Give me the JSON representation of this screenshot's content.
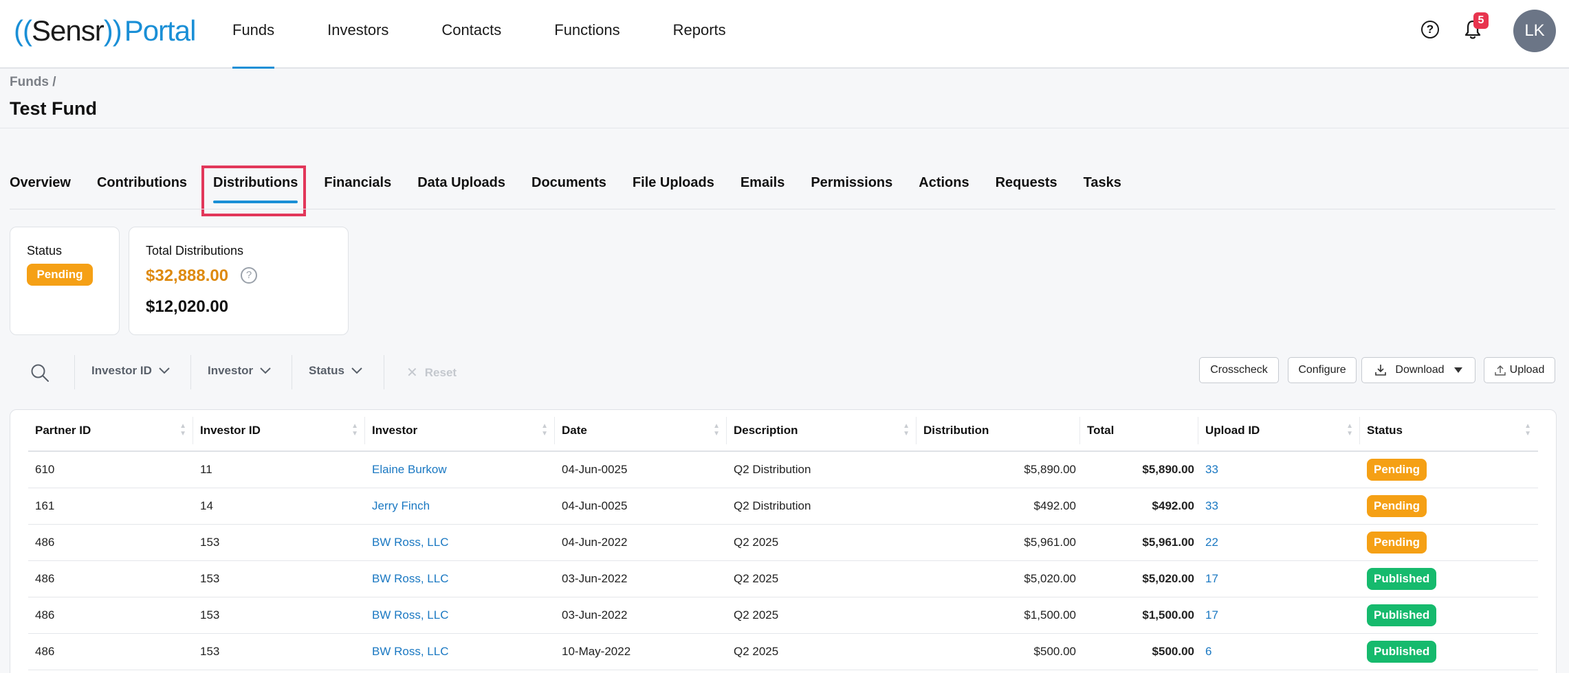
{
  "logo": {
    "open_paren": "((",
    "sensr": "Sensr",
    "close_paren": "))",
    "portal": "Portal"
  },
  "nav": {
    "items": [
      "Funds",
      "Investors",
      "Contacts",
      "Functions",
      "Reports"
    ],
    "active": "Funds"
  },
  "header": {
    "help_icon": "question-circle-icon",
    "notifications": {
      "icon": "bell-icon",
      "count": "5"
    },
    "avatar_initials": "LK"
  },
  "breadcrumb": "Funds /",
  "page_title": "Test Fund",
  "tabs": {
    "items": [
      "Overview",
      "Contributions",
      "Distributions",
      "Financials",
      "Data Uploads",
      "Documents",
      "File Uploads",
      "Emails",
      "Permissions",
      "Actions",
      "Requests",
      "Tasks"
    ],
    "active": "Distributions"
  },
  "cards": {
    "status": {
      "label": "Status",
      "value": "Pending"
    },
    "total": {
      "label": "Total Distributions",
      "amount_orange": "$32,888.00",
      "amount_black": "$12,020.00",
      "info_icon": "question-circle-icon"
    }
  },
  "toolbar": {
    "search_icon": "search-icon",
    "filters": [
      "Investor ID",
      "Investor",
      "Status"
    ],
    "reset_label": "Reset",
    "buttons": {
      "crosscheck": "Crosscheck",
      "configure": "Configure",
      "download": "Download",
      "upload": "Upload"
    }
  },
  "table": {
    "columns": [
      "Partner ID",
      "Investor ID",
      "Investor",
      "Date",
      "Description",
      "Distribution",
      "Total",
      "Upload ID",
      "Status"
    ],
    "rows": [
      {
        "partner_id": "610",
        "investor_id": "11",
        "investor": "Elaine Burkow",
        "date": "04-Jun-0025",
        "description": "Q2 Distribution",
        "distribution": "$5,890.00",
        "total": "$5,890.00",
        "upload_id": "33",
        "status": "Pending"
      },
      {
        "partner_id": "161",
        "investor_id": "14",
        "investor": "Jerry Finch",
        "date": "04-Jun-0025",
        "description": "Q2 Distribution",
        "distribution": "$492.00",
        "total": "$492.00",
        "upload_id": "33",
        "status": "Pending"
      },
      {
        "partner_id": "486",
        "investor_id": "153",
        "investor": "BW Ross, LLC",
        "date": "04-Jun-2022",
        "description": "Q2 2025",
        "distribution": "$5,961.00",
        "total": "$5,961.00",
        "upload_id": "22",
        "status": "Pending"
      },
      {
        "partner_id": "486",
        "investor_id": "153",
        "investor": "BW Ross, LLC",
        "date": "03-Jun-2022",
        "description": "Q2 2025",
        "distribution": "$5,020.00",
        "total": "$5,020.00",
        "upload_id": "17",
        "status": "Published"
      },
      {
        "partner_id": "486",
        "investor_id": "153",
        "investor": "BW Ross, LLC",
        "date": "03-Jun-2022",
        "description": "Q2 2025",
        "distribution": "$1,500.00",
        "total": "$1,500.00",
        "upload_id": "17",
        "status": "Published"
      },
      {
        "partner_id": "486",
        "investor_id": "153",
        "investor": "BW Ross, LLC",
        "date": "10-May-2022",
        "description": "Q2 2025",
        "distribution": "$500.00",
        "total": "$500.00",
        "upload_id": "6",
        "status": "Published"
      }
    ]
  },
  "colors": {
    "accent": "#1a8fd6",
    "pending": "#f5a015",
    "published": "#16ba6d",
    "notification": "#e8344e",
    "highlight": "#e2375a",
    "orange_total": "#de8a0f"
  }
}
